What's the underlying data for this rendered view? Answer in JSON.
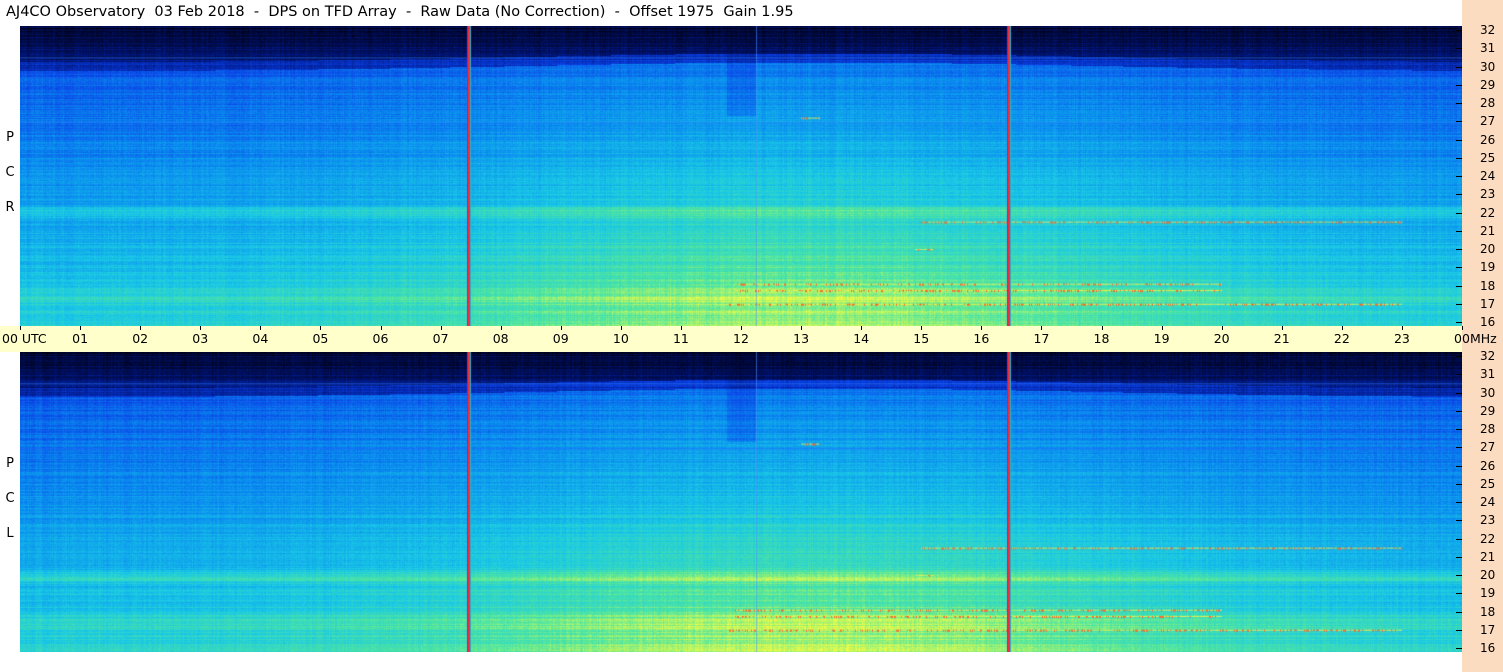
{
  "title": "AJ4CO Observatory  03 Feb 2018  -  DPS on TFD Array  -  Raw Data (No Correction)  -  Offset 1975  Gain 1.95",
  "polarizations": {
    "top": [
      "R",
      "C",
      "P"
    ],
    "bottom": [
      "L",
      "C",
      "P"
    ]
  },
  "time_axis": {
    "labels": [
      "00 UTC",
      "01",
      "02",
      "03",
      "04",
      "05",
      "06",
      "07",
      "08",
      "09",
      "10",
      "11",
      "12",
      "13",
      "14",
      "15",
      "16",
      "17",
      "18",
      "19",
      "20",
      "21",
      "22",
      "23",
      "00"
    ],
    "end_unit": "MHz"
  },
  "colors": {
    "background": "#ffffff",
    "time_axis_bg": "#ffffcc",
    "freq_axis_bg": "#fcdcc0",
    "colormap": [
      "#000010",
      "#00157a",
      "#0a40e6",
      "#0a8cf0",
      "#19c8e6",
      "#50e6a0",
      "#ffff3c",
      "#ff3c1e"
    ]
  },
  "chart_data": {
    "type": "heatmap",
    "panels": [
      "R C P",
      "L C P"
    ],
    "x": {
      "label": "UTC",
      "range_hours": [
        0,
        24
      ],
      "ticks": [
        "00",
        "01",
        "02",
        "03",
        "04",
        "05",
        "06",
        "07",
        "08",
        "09",
        "10",
        "11",
        "12",
        "13",
        "14",
        "15",
        "16",
        "17",
        "18",
        "19",
        "20",
        "21",
        "22",
        "23",
        "00"
      ]
    },
    "y": {
      "unit": "MHz",
      "range": [
        16,
        32
      ],
      "ticks": [
        16,
        17,
        18,
        19,
        20,
        21,
        22,
        23,
        24,
        25,
        26,
        27,
        28,
        29,
        30,
        31,
        32
      ]
    },
    "vertical_lines_utc": [
      7.45,
      16.45
    ],
    "rfi_bands_mhz": [
      {
        "mhz": 17.0,
        "from": 11.8,
        "to": 23.0
      },
      {
        "mhz": 17.75,
        "from": 11.9,
        "to": 20.0
      },
      {
        "mhz": 18.1,
        "from": 11.9,
        "to": 20.0
      },
      {
        "mhz": 20.0,
        "from": 14.9,
        "to": 15.2
      },
      {
        "mhz": 21.5,
        "from": 15.0,
        "to": 23.0
      },
      {
        "mhz": 27.2,
        "from": 13.0,
        "to": 13.3
      }
    ]
  }
}
